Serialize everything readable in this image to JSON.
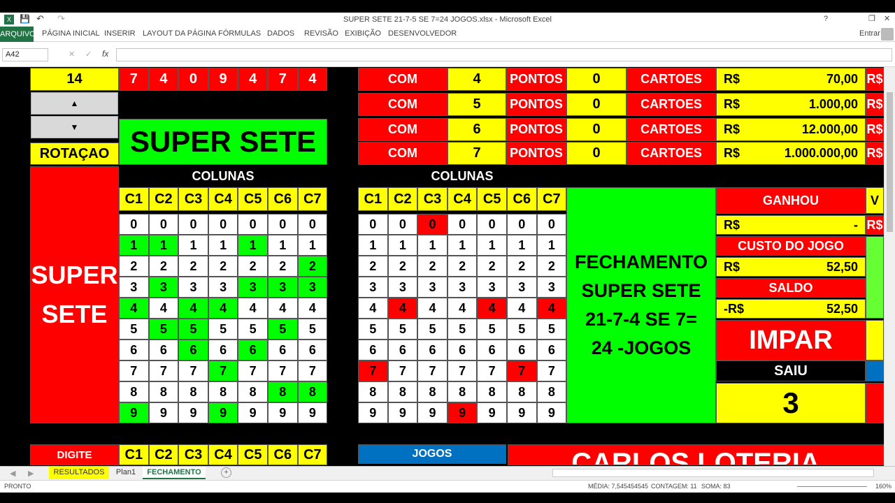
{
  "window": {
    "title": "SUPER SETE 21-7-5 SE 7=24 JOGOS.xlsx - Microsoft Excel",
    "signin": "Entrar"
  },
  "ribbon": {
    "tabs": [
      "ARQUIVO",
      "PÁGINA INICIAL",
      "INSERIR",
      "LAYOUT DA PÁGINA",
      "FÓRMULAS",
      "DADOS",
      "REVISÃO",
      "EXIBIÇÃO",
      "DESENVOLVEDOR"
    ]
  },
  "formula_bar": {
    "namebox": "A42",
    "fx": "fx",
    "content": ""
  },
  "left": {
    "count": "14",
    "digits": [
      "7",
      "4",
      "0",
      "9",
      "4",
      "7",
      "4"
    ],
    "spin_up": "▲",
    "spin_down": "▼",
    "rotacao": "ROTAÇAO",
    "super_sete": "SUPER SETE",
    "colunas": "COLUNAS",
    "big_label_1": "SUPER",
    "big_label_2": "SETE"
  },
  "columns": [
    "C1",
    "C2",
    "C3",
    "C4",
    "C5",
    "C6",
    "C7"
  ],
  "rows": [
    "0",
    "1",
    "2",
    "3",
    "4",
    "5",
    "6",
    "7",
    "8",
    "9"
  ],
  "prizes": [
    {
      "com": "COM",
      "n": "4",
      "pontos": "PONTOS",
      "qty": "0",
      "cartoes": "CARTOES",
      "rs": "R$",
      "value": "70,00"
    },
    {
      "com": "COM",
      "n": "5",
      "pontos": "PONTOS",
      "qty": "0",
      "cartoes": "CARTOES",
      "rs": "R$",
      "value": "1.000,00"
    },
    {
      "com": "COM",
      "n": "6",
      "pontos": "PONTOS",
      "qty": "0",
      "cartoes": "CARTOES",
      "rs": "R$",
      "value": "12.000,00"
    },
    {
      "com": "COM",
      "n": "7",
      "pontos": "PONTOS",
      "qty": "0",
      "cartoes": "CARTOES",
      "rs": "R$",
      "value": "1.000.000,00"
    }
  ],
  "right": {
    "colunas": "COLUNAS",
    "fechamento": [
      "FECHAMENTO",
      "SUPER SETE",
      "21-7-4 SE 7=",
      "24 -JOGOS"
    ],
    "ganhou": "GANHOU",
    "ganhou_rs": "R$",
    "ganhou_val": "-",
    "custo": "CUSTO DO JOGO",
    "custo_rs": "R$",
    "custo_val": "52,50",
    "saldo": "SALDO",
    "saldo_rs": "-R$",
    "saldo_val": "52,50",
    "impar": "IMPAR",
    "saiu": "SAIU",
    "saiu_val": "3",
    "edge_rs": "R$",
    "edge_v": "V"
  },
  "bottom": {
    "digite": "DIGITE",
    "jogos": "JOGOS",
    "banner": "CARLOS LOTERIA"
  },
  "sheets": [
    "RESULTADOS",
    "Plan1",
    "FECHAMENTO"
  ],
  "status": {
    "ready": "PRONTO",
    "media": "MÉDIA: 7,545454545",
    "contagem": "CONTAGEM: 11",
    "soma": "SOMA: 83",
    "zoom": "160%"
  },
  "colors": {
    "yellow": "#ffff00",
    "red": "#ff0000",
    "green": "#00ff00",
    "excel_green": "#217346",
    "blue": "#0070c0"
  },
  "left_grid_green": [
    [],
    [
      0,
      1,
      4
    ],
    [
      6
    ],
    [
      1,
      4,
      5,
      6
    ],
    [
      0,
      2,
      3
    ],
    [
      1,
      2,
      5
    ],
    [
      2,
      4
    ],
    [
      3
    ],
    [
      5,
      6
    ],
    [
      0,
      3
    ]
  ],
  "right_grid_red": [
    [
      2
    ],
    [],
    [],
    [],
    [
      1,
      4,
      6
    ],
    [],
    [],
    [
      0,
      5
    ],
    [],
    [
      3
    ]
  ]
}
